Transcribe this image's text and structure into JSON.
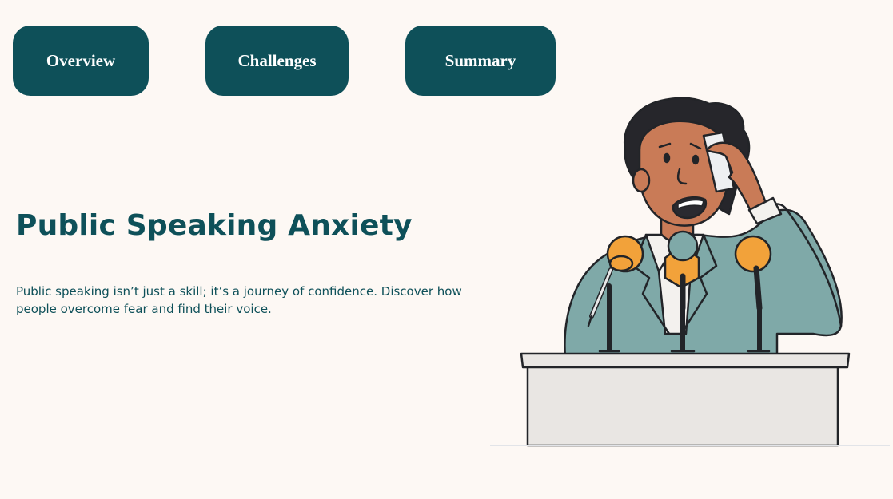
{
  "nav": {
    "overview_label": "Overview",
    "challenges_label": "Challenges",
    "summary_label": "Summary"
  },
  "hero": {
    "title": "Public Speaking Anxiety",
    "description": "Public speaking isn’t just a skill; it’s a journey of confidence. Discover how people overcome fear and find their voice."
  },
  "illustration": {
    "icon": "nervous-speaker-at-podium-illustration"
  },
  "colors": {
    "brand": "#0e5059",
    "background": "#fdf8f4",
    "button_text": "#ffffff",
    "jacket": "#7fa9a8",
    "microphone": "#f2a23a",
    "skin": "#c97b57"
  }
}
